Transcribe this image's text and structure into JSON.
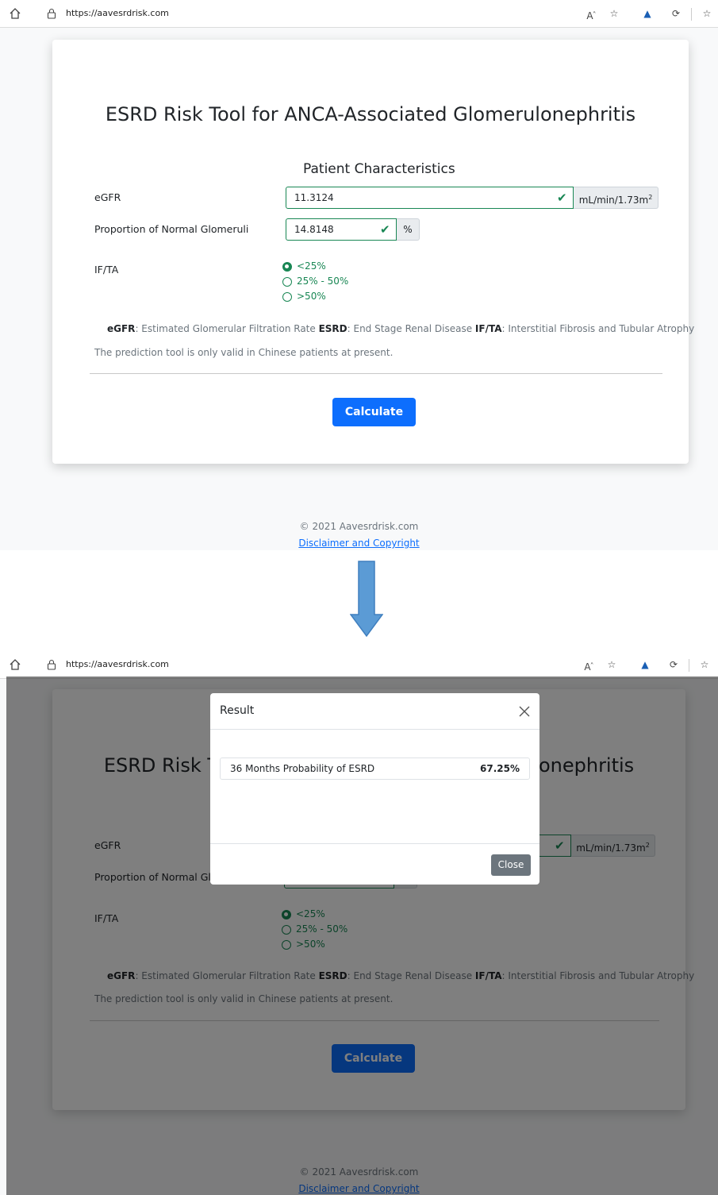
{
  "browser": {
    "url": "https://aavesrdrisk.com"
  },
  "page": {
    "title": "ESRD Risk Tool for ANCA-Associated Glomerulonephritis",
    "section_title": "Patient Characteristics",
    "egfr": {
      "label": "eGFR",
      "value": "11.3124",
      "unit": "mL/min/1.73m",
      "unit_sup": "2"
    },
    "png": {
      "label": "Proportion of Normal Glomeruli",
      "value": "14.8148",
      "unit": "%"
    },
    "ifta": {
      "label": "IF/TA",
      "options": [
        {
          "label": "<25%",
          "selected": true
        },
        {
          "label": "25% - 50%",
          "selected": false
        },
        {
          "label": ">50%",
          "selected": false
        }
      ]
    },
    "abbrev": {
      "egfr_term": "eGFR",
      "egfr_def": ": Estimated Glomerular Filtration Rate ",
      "esrd_term": "ESRD",
      "esrd_def": ": End Stage Renal Disease ",
      "ifta_term": "IF/TA",
      "ifta_def": ": Interstitial Fibrosis and Tubular Atrophy"
    },
    "note": "The prediction tool is only valid in Chinese patients at present.",
    "calculate_label": "Calculate",
    "footer_copy": "© 2021 Aavesrdrisk.com",
    "footer_link": "Disclaimer and Copyright"
  },
  "modal": {
    "title": "Result",
    "result_label": "36 Months Probability of ESRD",
    "result_value": "67.25%",
    "close_label": "Close"
  },
  "colors": {
    "primary": "#0d6efd",
    "success": "#198754",
    "secondary": "#6c757d",
    "arrow": "#5b9bd5"
  }
}
